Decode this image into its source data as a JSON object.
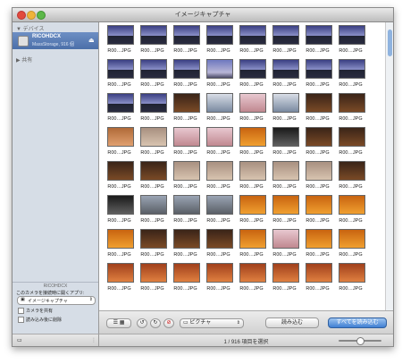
{
  "window": {
    "title": "イメージキャプチャ"
  },
  "sidebar": {
    "devices_label": "デバイス",
    "device": {
      "name": "RICOHDCX",
      "sub": "MassStorage, 916 個",
      "icon": "camera-icon"
    },
    "shared_label": "共有"
  },
  "device_panel": {
    "title": "RICOHDCX",
    "connect_label": "このカメラを接続時に開くアプリ:",
    "app_selected": "イメージキャプチャ",
    "share_camera": "カメラを共有",
    "delete_after": "読み込み後に削除"
  },
  "thumb_caption": "R00…JPG",
  "photos": [
    "bridge",
    "bridge",
    "bridge",
    "bridge",
    "bridge",
    "bridge",
    "bridge",
    "bridge",
    "bridge",
    "bridge",
    "bridge",
    "dusk",
    "bridge",
    "bridge",
    "bridge",
    "bridge",
    "bridge",
    "bridge",
    "dark",
    "object",
    "box",
    "object",
    "dark",
    "dark",
    "cushion",
    "food",
    "box",
    "box",
    "orange",
    "phone",
    "dark",
    "dark",
    "dark",
    "dark",
    "food",
    "food",
    "food",
    "food",
    "food",
    "dark",
    "phone",
    "city",
    "city",
    "city",
    "orange",
    "orange",
    "orange",
    "orange",
    "orange",
    "dark",
    "dark",
    "dark",
    "orange",
    "box",
    "orange",
    "orange",
    "party",
    "party",
    "party",
    "party",
    "party",
    "party",
    "party",
    "party"
  ],
  "palettes": {
    "bridge": "linear-gradient(#3a3f82 0%,#8b90c8 55%,#1f2232 56%,#2a2c40 100%)",
    "dusk": "linear-gradient(#6e78bf,#b8b6d6 70%,#4a4a66)",
    "dark": "linear-gradient(#3a2418,#7a4a26)",
    "object": "linear-gradient(#d8dde6,#7a8aa0)",
    "box": "linear-gradient(#e8c8d0,#c08890)",
    "cushion": "linear-gradient(#b06a38,#e0a070)",
    "food": "linear-gradient(#a89080,#d8c4b0)",
    "orange": "linear-gradient(#c86410,#f0a030)",
    "phone": "linear-gradient(#1a1a1a,#606060)",
    "city": "linear-gradient(#9aa4b4,#5a5f66)",
    "party": "linear-gradient(#a0401c,#e08040)"
  },
  "toolbar": {
    "view_mode": "list-grid-icon",
    "rotate_left": "rotate-left-icon",
    "rotate_right": "rotate-right-icon",
    "delete": "delete-icon",
    "destination": "ピクチャ",
    "import": "読み込む",
    "import_all": "すべてを読み込む"
  },
  "status": {
    "text": "1 / 916 項目を選択"
  }
}
